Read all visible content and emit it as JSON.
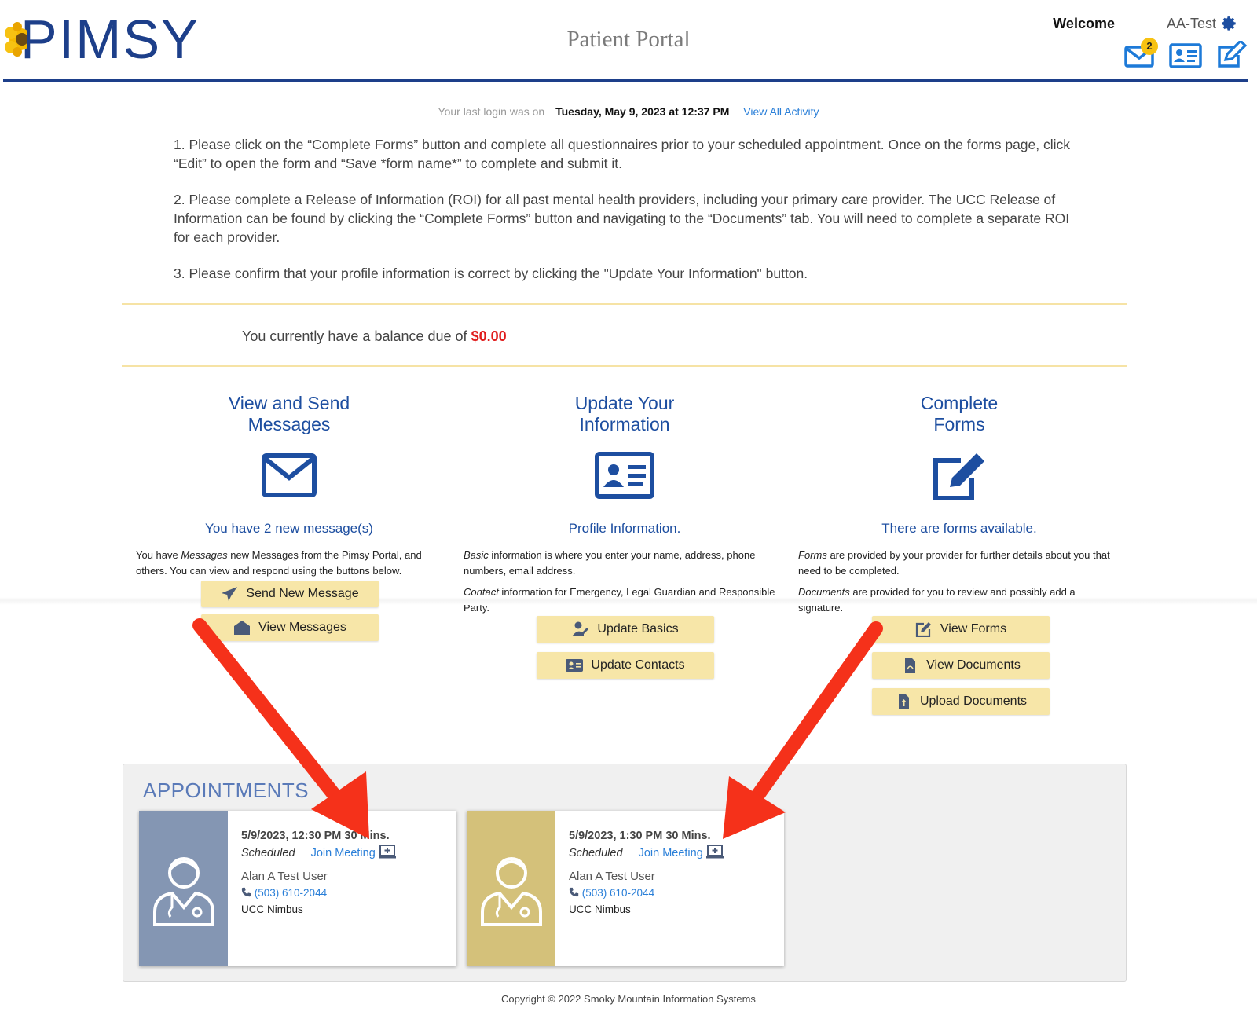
{
  "header": {
    "logo_text": "PIMSY",
    "portal_title": "Patient Portal",
    "welcome_label": "Welcome",
    "welcome_user": "AA-Test",
    "messages_badge": "2"
  },
  "login": {
    "label": "Your last login was on",
    "datetime": "Tuesday, May 9, 2023 at 12:37 PM",
    "activity_link": "View All Activity"
  },
  "instructions": [
    "1. Please click on the “Complete Forms” button and complete all questionnaires prior to your scheduled appointment. Once on the forms page, click “Edit” to open the form and “Save *form name*” to complete and submit it.",
    "2. Please complete a Release of Information (ROI) for all past mental health providers, including your primary care provider.  The UCC Release of Information can be found by clicking the “Complete Forms” button and navigating to the “Documents” tab. You will need to complete a separate ROI for each provider.",
    "3. Please confirm that your profile information is correct by clicking the \"Update Your Information\" button."
  ],
  "balance": {
    "label": "You currently have a balance due of",
    "amount": "$0.00"
  },
  "messages": {
    "title_1": "View and Send",
    "title_2": "Messages",
    "subtitle": "You have 2 new message(s)",
    "desc_pre": "You have ",
    "desc_em": "Messages",
    "desc_post": " new Messages from the Pimsy Portal, and others. You can view and respond using the buttons below.",
    "btn_send": "Send New Message",
    "btn_view": "View Messages"
  },
  "info": {
    "title_1": "Update Your",
    "title_2": "Information",
    "subtitle": "Profile Information.",
    "basic_em": "Basic",
    "basic_text": " information is where you enter your name, address, phone numbers, email address.",
    "contact_em": "Contact",
    "contact_text": " information for Emergency, Legal Guardian and Responsible Party.",
    "btn_basics": "Update Basics",
    "btn_contacts": "Update Contacts"
  },
  "forms": {
    "title_1": "Complete",
    "title_2": "Forms",
    "subtitle": "There are forms available.",
    "forms_em": "Forms",
    "forms_text": " are provided by your provider for further details about you that need to be completed.",
    "docs_em": "Documents",
    "docs_text": " are provided for you to review and possibly add a signature.",
    "btn_view_forms": "View Forms",
    "btn_view_docs": "View Documents",
    "btn_upload_docs": "Upload Documents"
  },
  "appointments": {
    "heading": "APPOINTMENTS",
    "items": [
      {
        "when": "5/9/2023, 12:30 PM  30 Mins.",
        "status": "Scheduled",
        "join": "Join Meeting",
        "provider": "Alan A Test User",
        "phone": "(503) 610-2044",
        "location": "UCC Nimbus",
        "color": "#8496b3"
      },
      {
        "when": "5/9/2023, 1:30 PM  30 Mins.",
        "status": "Scheduled",
        "join": "Join Meeting",
        "provider": "Alan A Test User",
        "phone": "(503) 610-2044",
        "location": "UCC Nimbus",
        "color": "#d4c17a"
      }
    ]
  },
  "footer": {
    "copyright": "Copyright © 2022 Smoky Mountain Information Systems"
  },
  "colors": {
    "brand_blue": "#1d3f8a",
    "link_blue": "#2a7fd8",
    "button_yellow": "#f7e6a8",
    "balance_red": "#e01b1b",
    "annotation_arrow": "#f5311a"
  }
}
